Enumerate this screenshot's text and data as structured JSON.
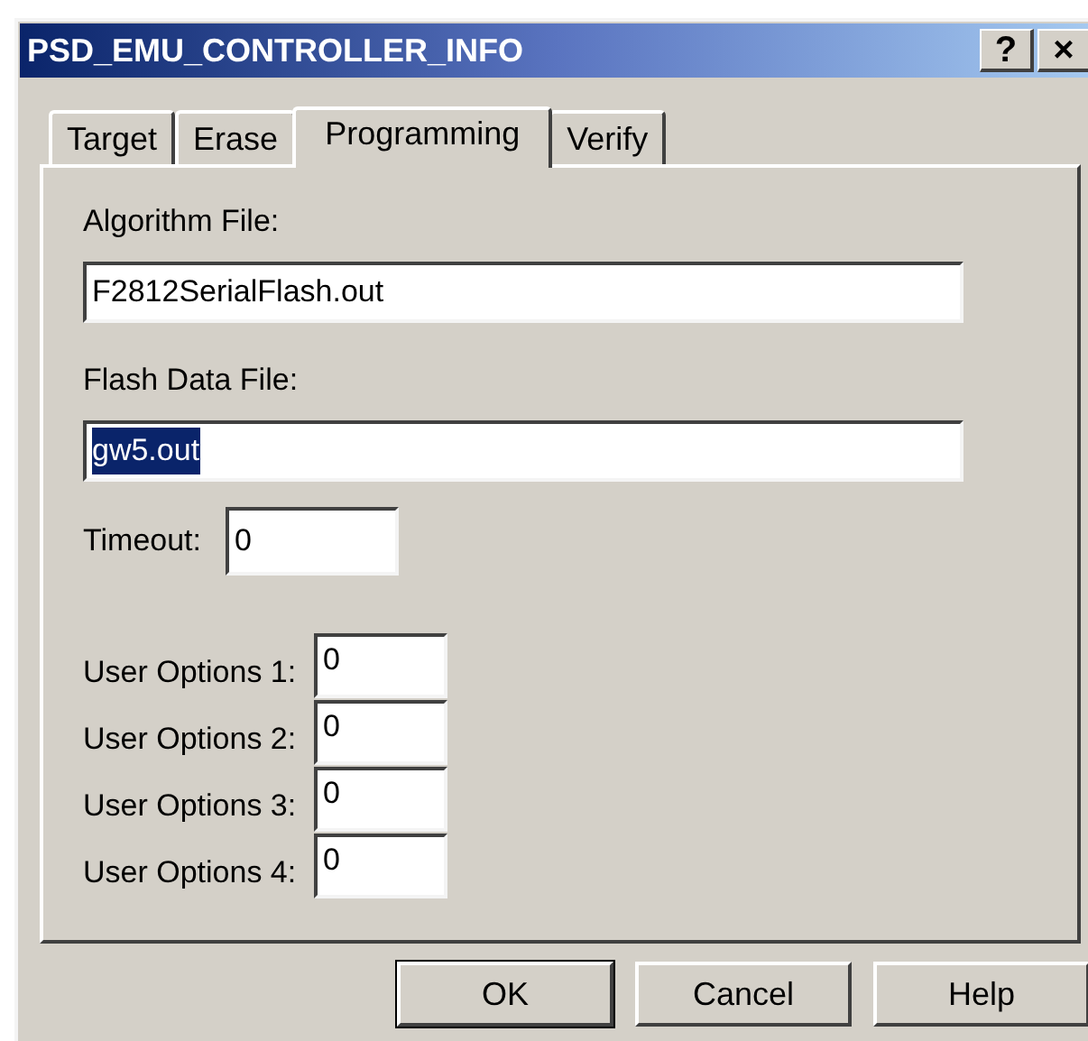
{
  "window": {
    "title": "PSD_EMU_CONTROLLER_INFO",
    "title_buttons": [
      "?",
      "×"
    ]
  },
  "tabs": [
    {
      "label": "Target",
      "selected": false
    },
    {
      "label": "Erase",
      "selected": false
    },
    {
      "label": "Programming",
      "selected": true
    },
    {
      "label": "Verify",
      "selected": false
    }
  ],
  "wide_fields": [
    {
      "label": "Algorithm File:",
      "value": "F2812SerialFlash.out",
      "text_selected": false
    },
    {
      "label": "Flash Data File:",
      "value": "gw5.out",
      "text_selected": true
    }
  ],
  "timeout": {
    "label": "Timeout:",
    "value": "0"
  },
  "user_options": [
    {
      "label": "User Options 1:",
      "value": "0"
    },
    {
      "label": "User Options 2:",
      "value": "0"
    },
    {
      "label": "User Options 3:",
      "value": "0"
    },
    {
      "label": "User Options 4:",
      "value": "0"
    }
  ],
  "buttons": [
    {
      "label": "OK",
      "default": true
    },
    {
      "label": "Cancel",
      "default": false
    },
    {
      "label": "Help",
      "default": false
    }
  ]
}
